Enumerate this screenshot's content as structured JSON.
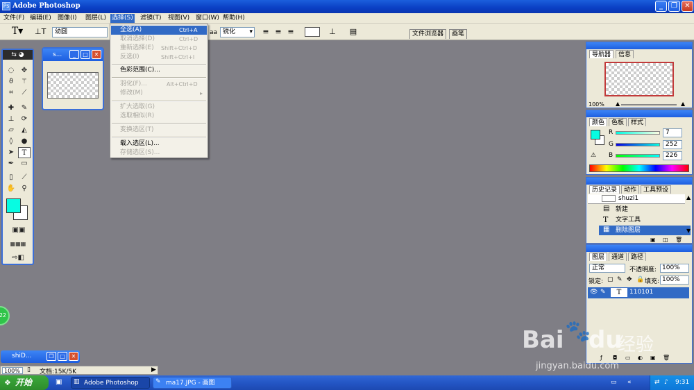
{
  "app": {
    "title": "Adobe Photoshop"
  },
  "menu": [
    {
      "label": "文件(F)"
    },
    {
      "label": "编辑(E)"
    },
    {
      "label": "图像(I)"
    },
    {
      "label": "图层(L)"
    },
    {
      "label": "选择(S)"
    },
    {
      "label": "滤镜(T)"
    },
    {
      "label": "视图(V)"
    },
    {
      "label": "窗口(W)"
    },
    {
      "label": "帮助(H)"
    }
  ],
  "options": {
    "font": "幼圆",
    "antialias": "锐化",
    "aa_prefix": "aa",
    "tab1": "文件浏览器",
    "tab2": "画笔"
  },
  "dropdown": {
    "items": [
      {
        "label": "全选(A)",
        "shortcut": "Ctrl+A"
      },
      {
        "label": "取消选择(D)",
        "shortcut": "Ctrl+D"
      },
      {
        "label": "重新选择(E)",
        "shortcut": "Shift+Ctrl+D"
      },
      {
        "label": "反选(I)",
        "shortcut": "Shift+Ctrl+I"
      },
      {
        "label": "色彩范围(C)...",
        "shortcut": ""
      },
      {
        "label": "羽化(F)...",
        "shortcut": "Alt+Ctrl+D"
      },
      {
        "label": "修改(M)",
        "shortcut": "▸"
      },
      {
        "label": "扩大选取(G)",
        "shortcut": ""
      },
      {
        "label": "选取相似(R)",
        "shortcut": ""
      },
      {
        "label": "变换选区(T)",
        "shortcut": ""
      },
      {
        "label": "载入选区(L)...",
        "shortcut": ""
      },
      {
        "label": "存储选区(S)...",
        "shortcut": ""
      }
    ]
  },
  "docwin": {
    "title": "s..."
  },
  "minwin": {
    "title": "shiD..."
  },
  "status": {
    "zoom": "100%",
    "doc": "文档:15K/5K"
  },
  "navigator": {
    "tab1": "导航器",
    "tab2": "信息",
    "zoom": "100%"
  },
  "color": {
    "tab1": "颜色",
    "tab2": "色板",
    "tab3": "样式",
    "r_label": "R",
    "g_label": "G",
    "b_label": "B",
    "r": "7",
    "g": "252",
    "b": "226",
    "swatch": "#07fce2"
  },
  "history": {
    "tab1": "历史记录",
    "tab2": "动作",
    "tab3": "工具预设",
    "doc_name": "shuzi1",
    "rows": [
      "新建",
      "文字工具",
      "删除图层"
    ]
  },
  "layers": {
    "tab1": "图层",
    "tab2": "通道",
    "tab3": "路径",
    "blend": "正常",
    "opacity_label": "不透明度:",
    "opacity": "100%",
    "lock_label": "锁定:",
    "fill_label": "填充:",
    "fill": "100%",
    "layer_name": "110101"
  },
  "taskbar": {
    "start": "开始",
    "task1": "Adobe Photoshop",
    "task2": "ma17.JPG - 画图",
    "clock": "9:31",
    "float_badge": "22"
  },
  "watermark": {
    "brand": "Bai",
    "brand2": "du",
    "cn": "经验",
    "url": "jingyan.baidu.com"
  }
}
